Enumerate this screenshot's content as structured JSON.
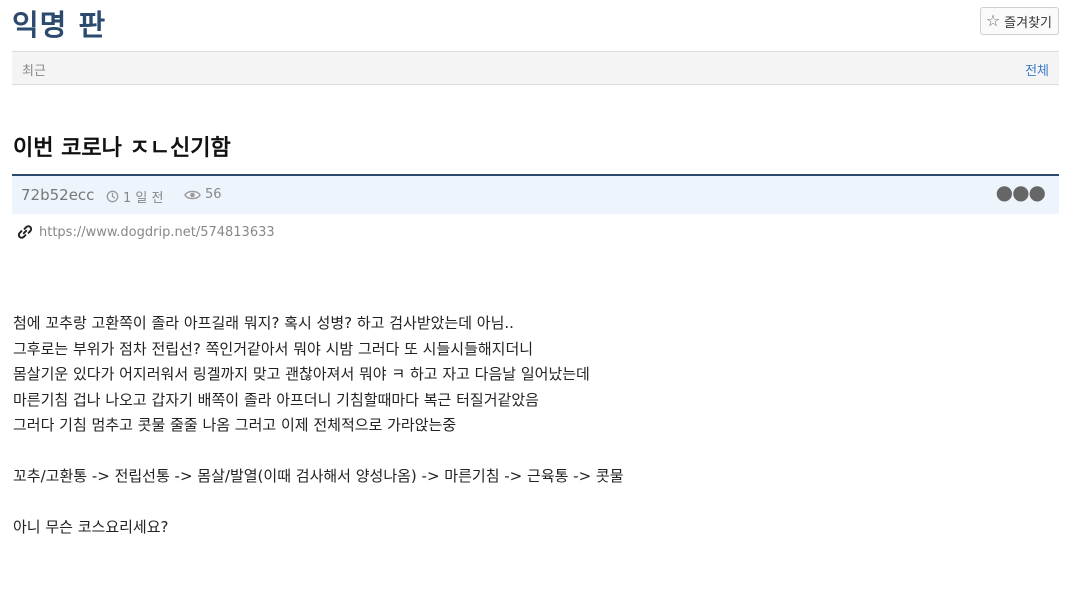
{
  "board": {
    "title": "익명 판",
    "favorite_label": "즐겨찾기"
  },
  "tabs": {
    "recent": "최근",
    "all": "전체"
  },
  "post": {
    "title": "이번 코로나 ㅈㄴ신기함",
    "author": "72b52ecc",
    "time": "1 일 전",
    "views": "56",
    "url": "https://www.dogdrip.net/574813633",
    "body": [
      "첨에 꼬추랑 고환쪽이 졸라 아프길래 뭐지? 혹시 성병? 하고 검사받았는데 아님..",
      "그후로는 부위가 점차 전립선? 쪽인거같아서 뭐야 시밤 그러다 또 시들시들해지더니",
      "몸살기운 있다가 어지러워서 링겔까지 맞고 괜찮아져서 뭐야 ㅋ 하고 자고 다음날 일어났는데",
      "마른기침 겁나 나오고 갑자기 배쪽이 졸라 아프더니 기침할때마다 복근 터질거같았음",
      "그러다 기침 멈추고 콧물 줄줄 나옴 그러고 이제 전체적으로 가라앉는중",
      "꼬추/고환통 -> 전립선통 -> 몸살/발열(이때 검사해서 양성나옴) -> 마른기침 -> 근육통 -> 콧물",
      "아니 무슨 코스요리세요?"
    ]
  },
  "icons": {
    "favorite": "star-outline-icon",
    "time": "clock-icon",
    "views": "eye-icon",
    "more": "more-dots-icon",
    "link": "link-icon"
  },
  "colors": {
    "title": "#2b4a6e",
    "link": "#3a7bc8",
    "meta_bg": "#edf4fc"
  }
}
